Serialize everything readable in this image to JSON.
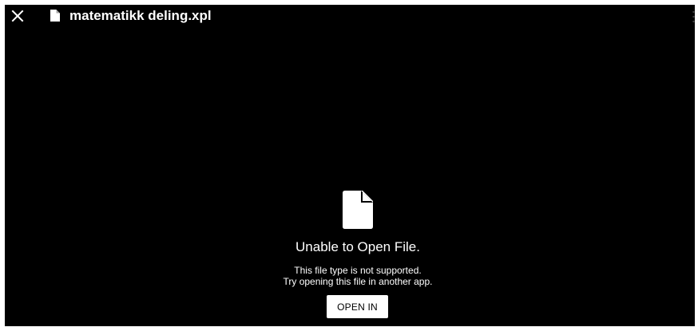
{
  "header": {
    "close_icon": "close-icon",
    "file_icon": "file-icon",
    "title": "matematikk deling.xpl"
  },
  "error": {
    "icon": "file-icon",
    "title": "Unable to Open File.",
    "line1": "This file type is not supported.",
    "line2": "Try opening this file in another app.",
    "button_label": "OPEN IN"
  },
  "colors": {
    "background": "#000000",
    "foreground": "#ffffff",
    "button_text": "#000000"
  }
}
